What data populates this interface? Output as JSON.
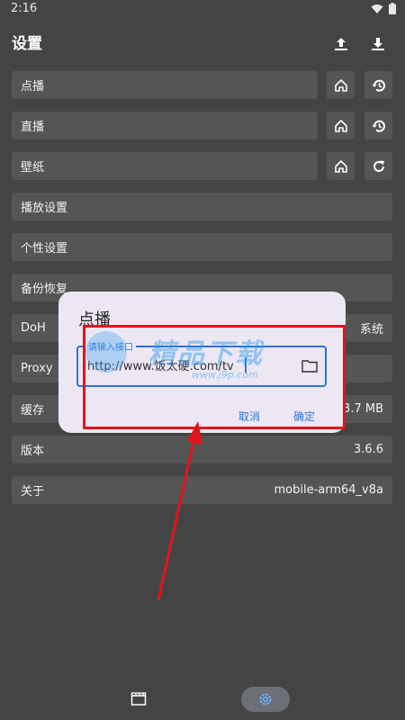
{
  "status": {
    "time": "2:16",
    "icons": [
      "wifi-icon",
      "battery-icon"
    ]
  },
  "header": {
    "title": "设置",
    "icons": [
      "upload-icon",
      "download-icon"
    ]
  },
  "rows": [
    {
      "label": "点播",
      "value": "",
      "actions": [
        "home-icon",
        "history-icon"
      ]
    },
    {
      "label": "直播",
      "value": "",
      "actions": [
        "home-icon",
        "history-icon"
      ]
    },
    {
      "label": "壁纸",
      "value": "",
      "actions": [
        "home-icon",
        "refresh-icon"
      ]
    },
    {
      "label": "播放设置",
      "value": ""
    },
    {
      "label": "个性设置",
      "value": ""
    },
    {
      "label": "备份恢复",
      "value": ""
    },
    {
      "label": "DoH",
      "value": "系统"
    },
    {
      "label": "Proxy",
      "value": ""
    },
    {
      "label": "缓存",
      "value": "3.7 MB"
    },
    {
      "label": "版本",
      "value": "3.6.6"
    },
    {
      "label": "关于",
      "value": "mobile-arm64_v8a"
    }
  ],
  "dialog": {
    "title": "点播",
    "input_label": "请输入接口",
    "input_value": "http://www.饭太硬.com/tv",
    "cancel": "取消",
    "confirm": "确定"
  },
  "watermark": {
    "main": "精品下载",
    "sub": "www.j9p.com"
  },
  "annotation_color": "#e3121b",
  "accent": "#2c74d6",
  "bottom_nav": {
    "icons": [
      "clapperboard-icon",
      "settings-gear-icon"
    ],
    "active": "settings-gear-icon"
  }
}
